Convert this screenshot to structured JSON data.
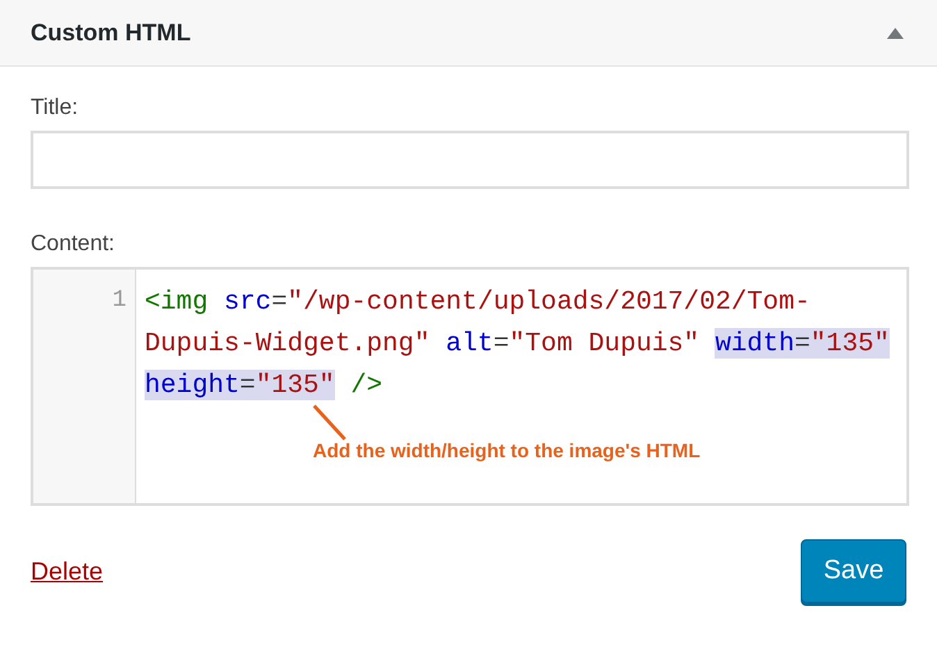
{
  "widget": {
    "title": "Custom HTML",
    "expanded": true
  },
  "title_field": {
    "label": "Title:"
  },
  "content_field": {
    "label": "Content:",
    "rows": [
      {
        "number": "1",
        "tokens": [
          {
            "text": "<img",
            "kind": "tag",
            "space_before": false,
            "highlighted": false
          },
          {
            "text": "src",
            "kind": "attr",
            "space_before": true,
            "highlighted": false
          },
          {
            "text": "=",
            "kind": "punct",
            "space_before": false,
            "highlighted": false
          },
          {
            "text": "\"/wp-content/uploads/2017/02/Tom-",
            "kind": "string",
            "space_before": false,
            "highlighted": false
          }
        ]
      },
      {
        "tokens": [
          {
            "text": "Dupuis-Widget.png\"",
            "kind": "string",
            "space_before": false,
            "highlighted": false
          },
          {
            "text": "alt",
            "kind": "attr",
            "space_before": true,
            "highlighted": false
          },
          {
            "text": "=",
            "kind": "punct",
            "space_before": false,
            "highlighted": false
          },
          {
            "text": "\"Tom Dupuis\"",
            "kind": "string",
            "space_before": false,
            "highlighted": false
          },
          {
            "text": "width",
            "kind": "attr",
            "space_before": true,
            "highlighted": true
          },
          {
            "text": "=",
            "kind": "punct",
            "space_before": false,
            "highlighted": true
          },
          {
            "text": "\"135\"",
            "kind": "string",
            "space_before": false,
            "highlighted": true
          }
        ]
      },
      {
        "tokens": [
          {
            "text": "height",
            "kind": "attr",
            "space_before": false,
            "highlighted": true
          },
          {
            "text": "=",
            "kind": "punct",
            "space_before": false,
            "highlighted": true
          },
          {
            "text": "\"135\"",
            "kind": "string",
            "space_before": false,
            "highlighted": true
          },
          {
            "text": "/>",
            "kind": "tag",
            "space_before": true,
            "highlighted": false
          }
        ]
      }
    ]
  },
  "annotation": "Add the width/height to the image's HTML",
  "delete_link": "Delete",
  "save_button": "Save"
}
